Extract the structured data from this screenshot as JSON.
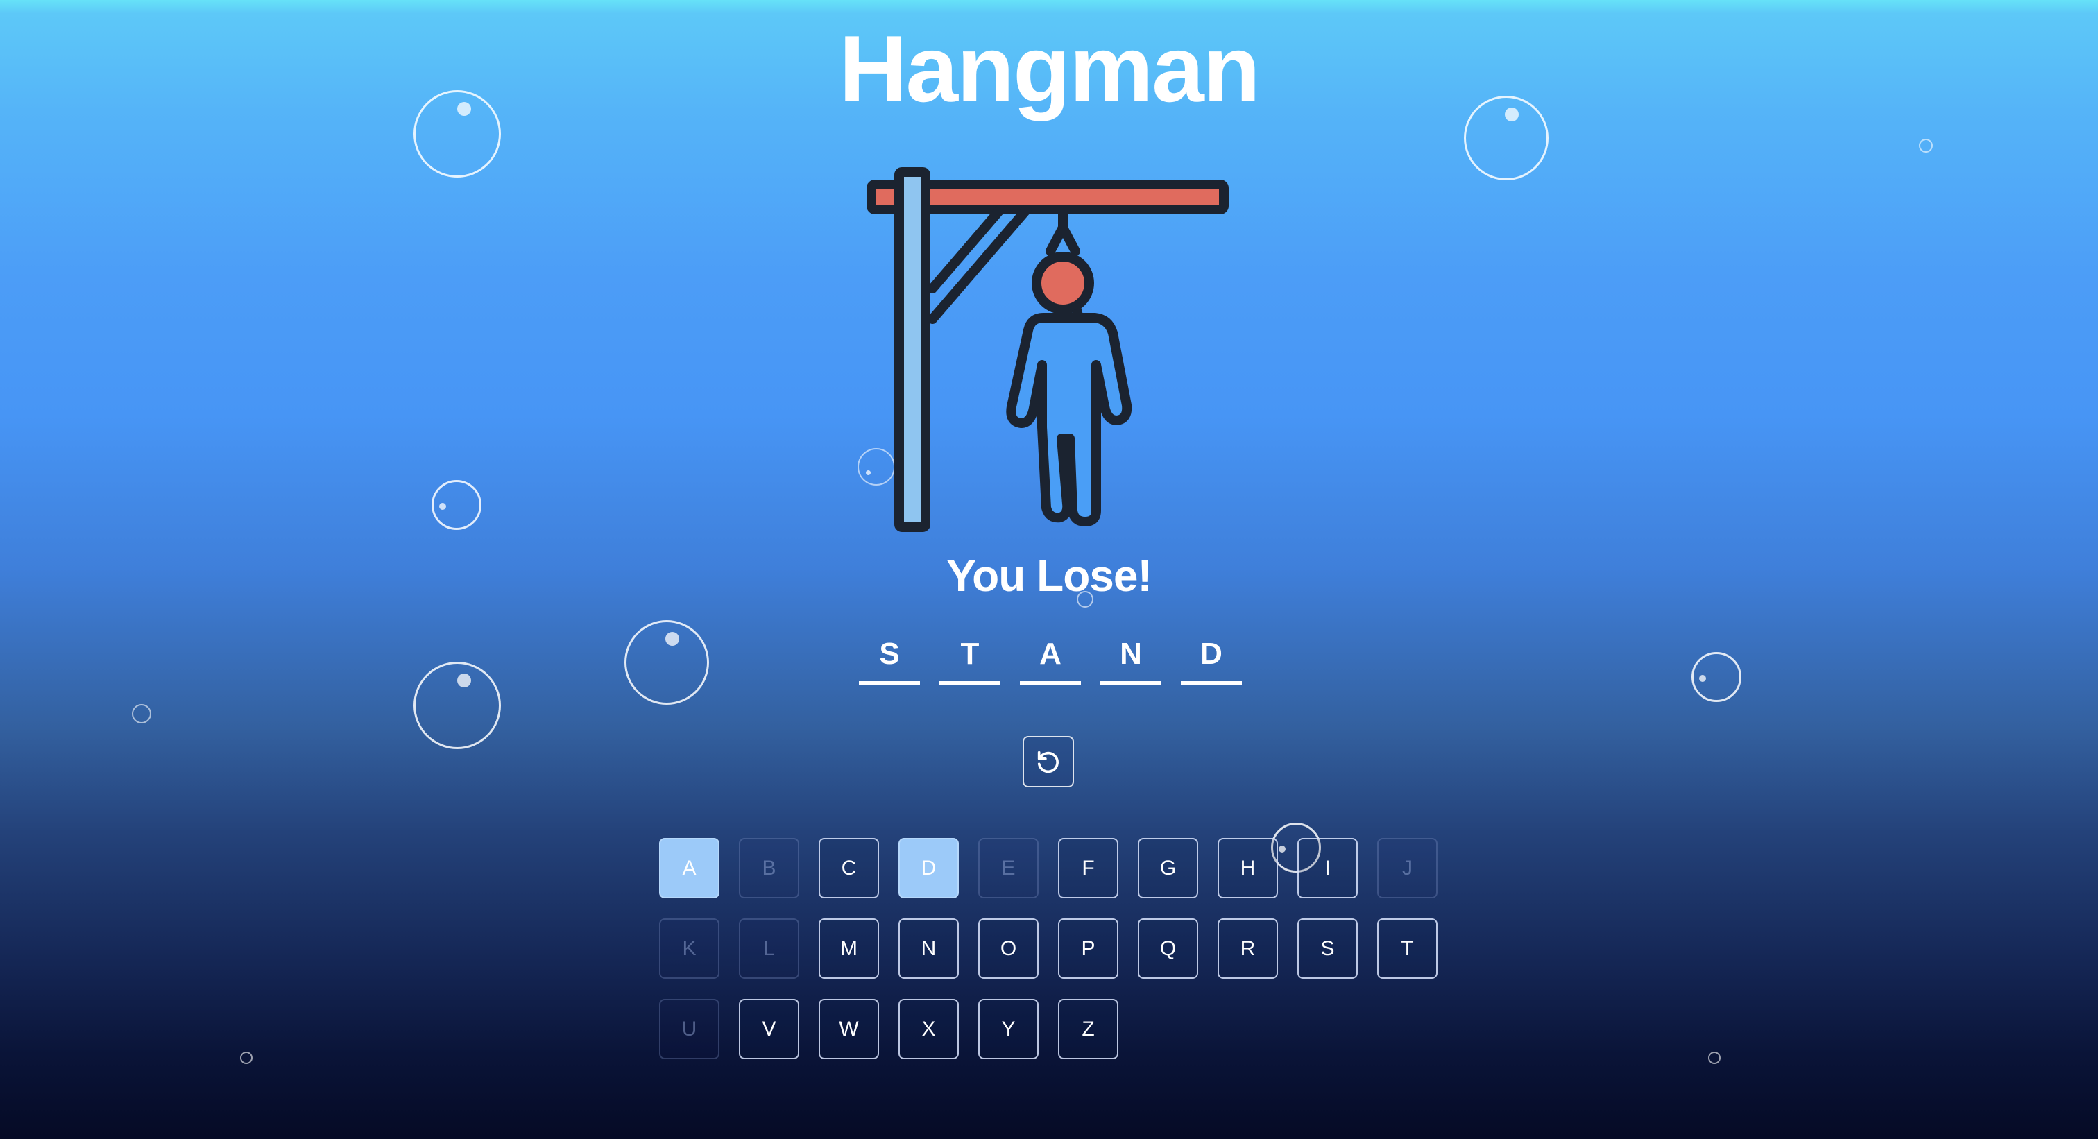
{
  "title": "Hangman",
  "result_message": "You Lose!",
  "word_letters": [
    "S",
    "T",
    "A",
    "N",
    "D"
  ],
  "reset_button": {
    "icon": "restart-icon"
  },
  "keyboard": {
    "rows": [
      [
        {
          "letter": "A",
          "state": "correct"
        },
        {
          "letter": "B",
          "state": "wrong"
        },
        {
          "letter": "C",
          "state": "unused"
        },
        {
          "letter": "D",
          "state": "correct"
        },
        {
          "letter": "E",
          "state": "wrong"
        },
        {
          "letter": "F",
          "state": "unused"
        },
        {
          "letter": "G",
          "state": "unused"
        },
        {
          "letter": "H",
          "state": "unused"
        },
        {
          "letter": "I",
          "state": "unused"
        },
        {
          "letter": "J",
          "state": "wrong"
        }
      ],
      [
        {
          "letter": "K",
          "state": "wrong"
        },
        {
          "letter": "L",
          "state": "wrong"
        },
        {
          "letter": "M",
          "state": "unused"
        },
        {
          "letter": "N",
          "state": "unused"
        },
        {
          "letter": "O",
          "state": "unused"
        },
        {
          "letter": "P",
          "state": "unused"
        },
        {
          "letter": "Q",
          "state": "unused"
        },
        {
          "letter": "R",
          "state": "unused"
        },
        {
          "letter": "S",
          "state": "unused"
        },
        {
          "letter": "T",
          "state": "unused"
        }
      ],
      [
        {
          "letter": "U",
          "state": "wrong"
        },
        {
          "letter": "V",
          "state": "unused"
        },
        {
          "letter": "W",
          "state": "unused"
        },
        {
          "letter": "X",
          "state": "unused"
        },
        {
          "letter": "Y",
          "state": "unused"
        },
        {
          "letter": "Z",
          "state": "unused"
        }
      ]
    ]
  },
  "colors": {
    "gallows_beam_fill": "#e06b5e",
    "gallows_post_fill": "#8fc5f0",
    "outline": "#1b2330",
    "head_fill": "#e06b5e",
    "body_fill": "#4a9ef6",
    "correct_key": "#9ccaf9"
  }
}
